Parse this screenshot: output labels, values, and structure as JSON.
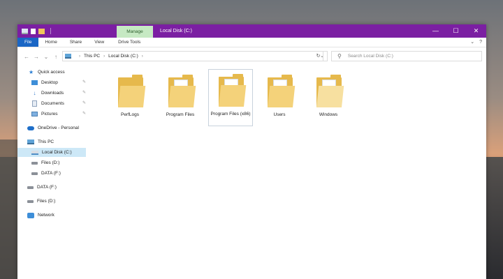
{
  "window": {
    "title": "Local Disk (C:)",
    "controls": {
      "minimize": "—",
      "maximize": "☐",
      "close": "✕"
    }
  },
  "ribbon": {
    "contextual_tab": "Manage",
    "tabs": [
      "File",
      "Home",
      "Share",
      "View",
      "Drive Tools"
    ],
    "expand_icon": "⌄",
    "help_icon": "?"
  },
  "navigation": {
    "back": "←",
    "forward": "→",
    "recent": "⌄",
    "up": "↑",
    "breadcrumb": [
      "This PC",
      "Local Disk (C:)"
    ],
    "crumb_separator": "›",
    "address_dropdown": "⌄",
    "refresh": "↻"
  },
  "search": {
    "placeholder": "Search Local Disk (C:)",
    "icon": "⚲"
  },
  "sidebar": {
    "quick_access": "Quick access",
    "items": [
      {
        "label": "Desktop",
        "icon": "desktop-icon",
        "pinned": true
      },
      {
        "label": "Downloads",
        "icon": "download-icon",
        "pinned": true
      },
      {
        "label": "Documents",
        "icon": "documents-icon",
        "pinned": true
      },
      {
        "label": "Pictures",
        "icon": "pictures-icon",
        "pinned": true
      }
    ],
    "onedrive": "OneDrive - Personal",
    "this_pc": "This PC",
    "pc_drives": [
      "Local Disk (C:)",
      "Files (D:)",
      "DATA (F:)"
    ],
    "external_drives": [
      "DATA (F:)",
      "Files (D:)"
    ],
    "network": "Network",
    "selected": "Local Disk (C:)"
  },
  "folders": [
    {
      "name": "PerfLogs",
      "type": "empty"
    },
    {
      "name": "Program Files",
      "type": "full"
    },
    {
      "name": "Program Files (x86)",
      "type": "full",
      "selected": true
    },
    {
      "name": "Users",
      "type": "full"
    },
    {
      "name": "Windows",
      "type": "full"
    }
  ],
  "colors": {
    "titlebar": "#7b1fa2",
    "manage_tab": "#c6e9c3",
    "file_tab": "#1a66c5",
    "selection": "#cde8f7",
    "folder": "#f4d27a"
  }
}
